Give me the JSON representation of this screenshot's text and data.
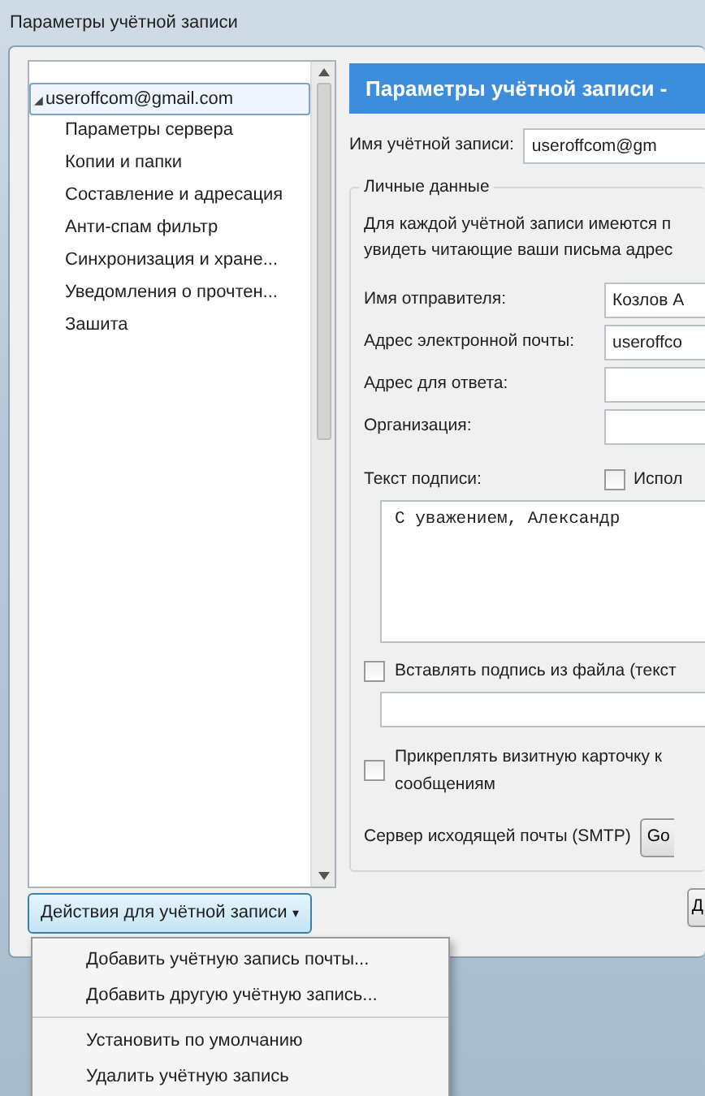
{
  "window": {
    "title": "Параметры учётной записи"
  },
  "tree": {
    "items": [
      {
        "label": "useroffcom@gmail.com",
        "expander": "◢",
        "expanded": true,
        "selected": true,
        "children": [
          {
            "label": "Параметры сервера"
          },
          {
            "label": "Копии и папки"
          },
          {
            "label": "Составление и адресация"
          },
          {
            "label": "Анти-спам фильтр"
          },
          {
            "label": "Синхронизация и хране..."
          },
          {
            "label": "Уведомления о прочтен..."
          },
          {
            "label": "Зашита"
          }
        ]
      }
    ]
  },
  "actions_button": {
    "label": "Действия для учётной записи",
    "caret": "▾"
  },
  "actions_menu": {
    "items": [
      {
        "label": "Добавить учётную запись почты..."
      },
      {
        "label": "Добавить другую учётную запись...",
        "separator_after": true
      },
      {
        "label": "Установить по умолчанию"
      },
      {
        "label": "Удалить учётную запись"
      }
    ]
  },
  "panel": {
    "header": "Параметры учётной записи -",
    "account_name": {
      "label": "Имя учётной записи:",
      "value": "useroffcom@gm"
    },
    "group": {
      "title": "Личные данные",
      "description": [
        "Для каждой учётной записи имеются п",
        "увидеть читающие ваши письма адрес"
      ]
    },
    "fields": [
      {
        "label": "Имя отправителя:",
        "value": "Козлов А"
      },
      {
        "label": "Адрес электронной почты:",
        "value": "useroffco"
      },
      {
        "label": "Адрес для ответа:"
      },
      {
        "label": "Организация:"
      }
    ],
    "signature": {
      "label": "Текст подписи:",
      "html_label": "Испол",
      "html_checked": false,
      "text": "С уважением, Александр"
    },
    "sig_file": {
      "label": "Вставлять подпись из файла (текст",
      "checked": false
    },
    "vcard": {
      "label": "Прикреплять визитную карточку к",
      "label_2": "сообщениям",
      "checked": false
    },
    "smtp": {
      "label": "Сервер исходящей почты (SMTP)",
      "button": "Go"
    },
    "bottom_button": "Д"
  }
}
